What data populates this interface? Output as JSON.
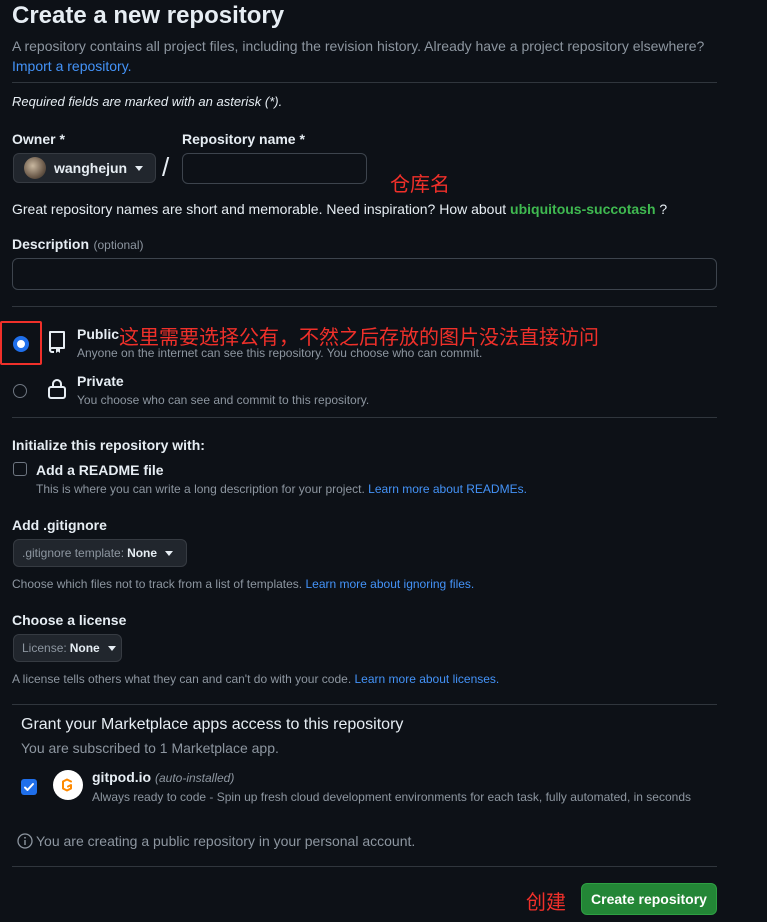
{
  "page": {
    "title": "Create a new repository",
    "intro_text": "A repository contains all project files, including the revision history. Already have a project repository elsewhere?",
    "import_link": "Import a repository.",
    "required_note": "Required fields are marked with an asterisk (*)."
  },
  "owner": {
    "label": "Owner *",
    "value": "wanghejun"
  },
  "repo_name": {
    "label": "Repository name *",
    "value": ""
  },
  "annotations": {
    "repo_name": "仓库名",
    "public_note": "这里需要选择公有，不然之后存放的图片没法直接访问",
    "create": "创建"
  },
  "suggestion": {
    "text": "Great repository names are short and memorable. Need inspiration? How about",
    "name": "ubiquitous-succotash",
    "suffix": "?"
  },
  "description": {
    "label": "Description",
    "optional": "(optional)",
    "value": ""
  },
  "visibility": {
    "selected": "public",
    "public": {
      "title": "Public",
      "desc": "Anyone on the internet can see this repository. You choose who can commit."
    },
    "private": {
      "title": "Private",
      "desc": "You choose who can see and commit to this repository."
    }
  },
  "init": {
    "heading": "Initialize this repository with:",
    "readme": {
      "label": "Add a README file",
      "desc": "This is where you can write a long description for your project.",
      "link": "Learn more about READMEs.",
      "checked": false
    }
  },
  "gitignore": {
    "heading": "Add .gitignore",
    "prefix": ".gitignore template:",
    "value": "None",
    "desc": "Choose which files not to track from a list of templates.",
    "link": "Learn more about ignoring files."
  },
  "license": {
    "heading": "Choose a license",
    "prefix": "License:",
    "value": "None",
    "desc": "A license tells others what they can and can't do with your code.",
    "link": "Learn more about licenses."
  },
  "marketplace": {
    "title": "Grant your Marketplace apps access to this repository",
    "subtitle": "You are subscribed to 1 Marketplace app.",
    "app_name": "gitpod.io",
    "app_tag": "(auto-installed)",
    "app_desc": "Always ready to code - Spin up fresh cloud development environments for each task, fully automated, in seconds",
    "checked": true
  },
  "footer": {
    "notice": "You are creating a public repository in your personal account.",
    "create_button": "Create repository"
  },
  "icons": {
    "repo": "repo-icon",
    "lock": "lock-icon",
    "info": "info-icon",
    "check": "check-icon",
    "gitpod": "gitpod-icon"
  },
  "colors": {
    "background": "#0d1117",
    "accent": "#1f6feb",
    "link": "#4493f8",
    "suggestion": "#3fb950",
    "primary_button": "#238636",
    "annotation": "#f0302a"
  }
}
